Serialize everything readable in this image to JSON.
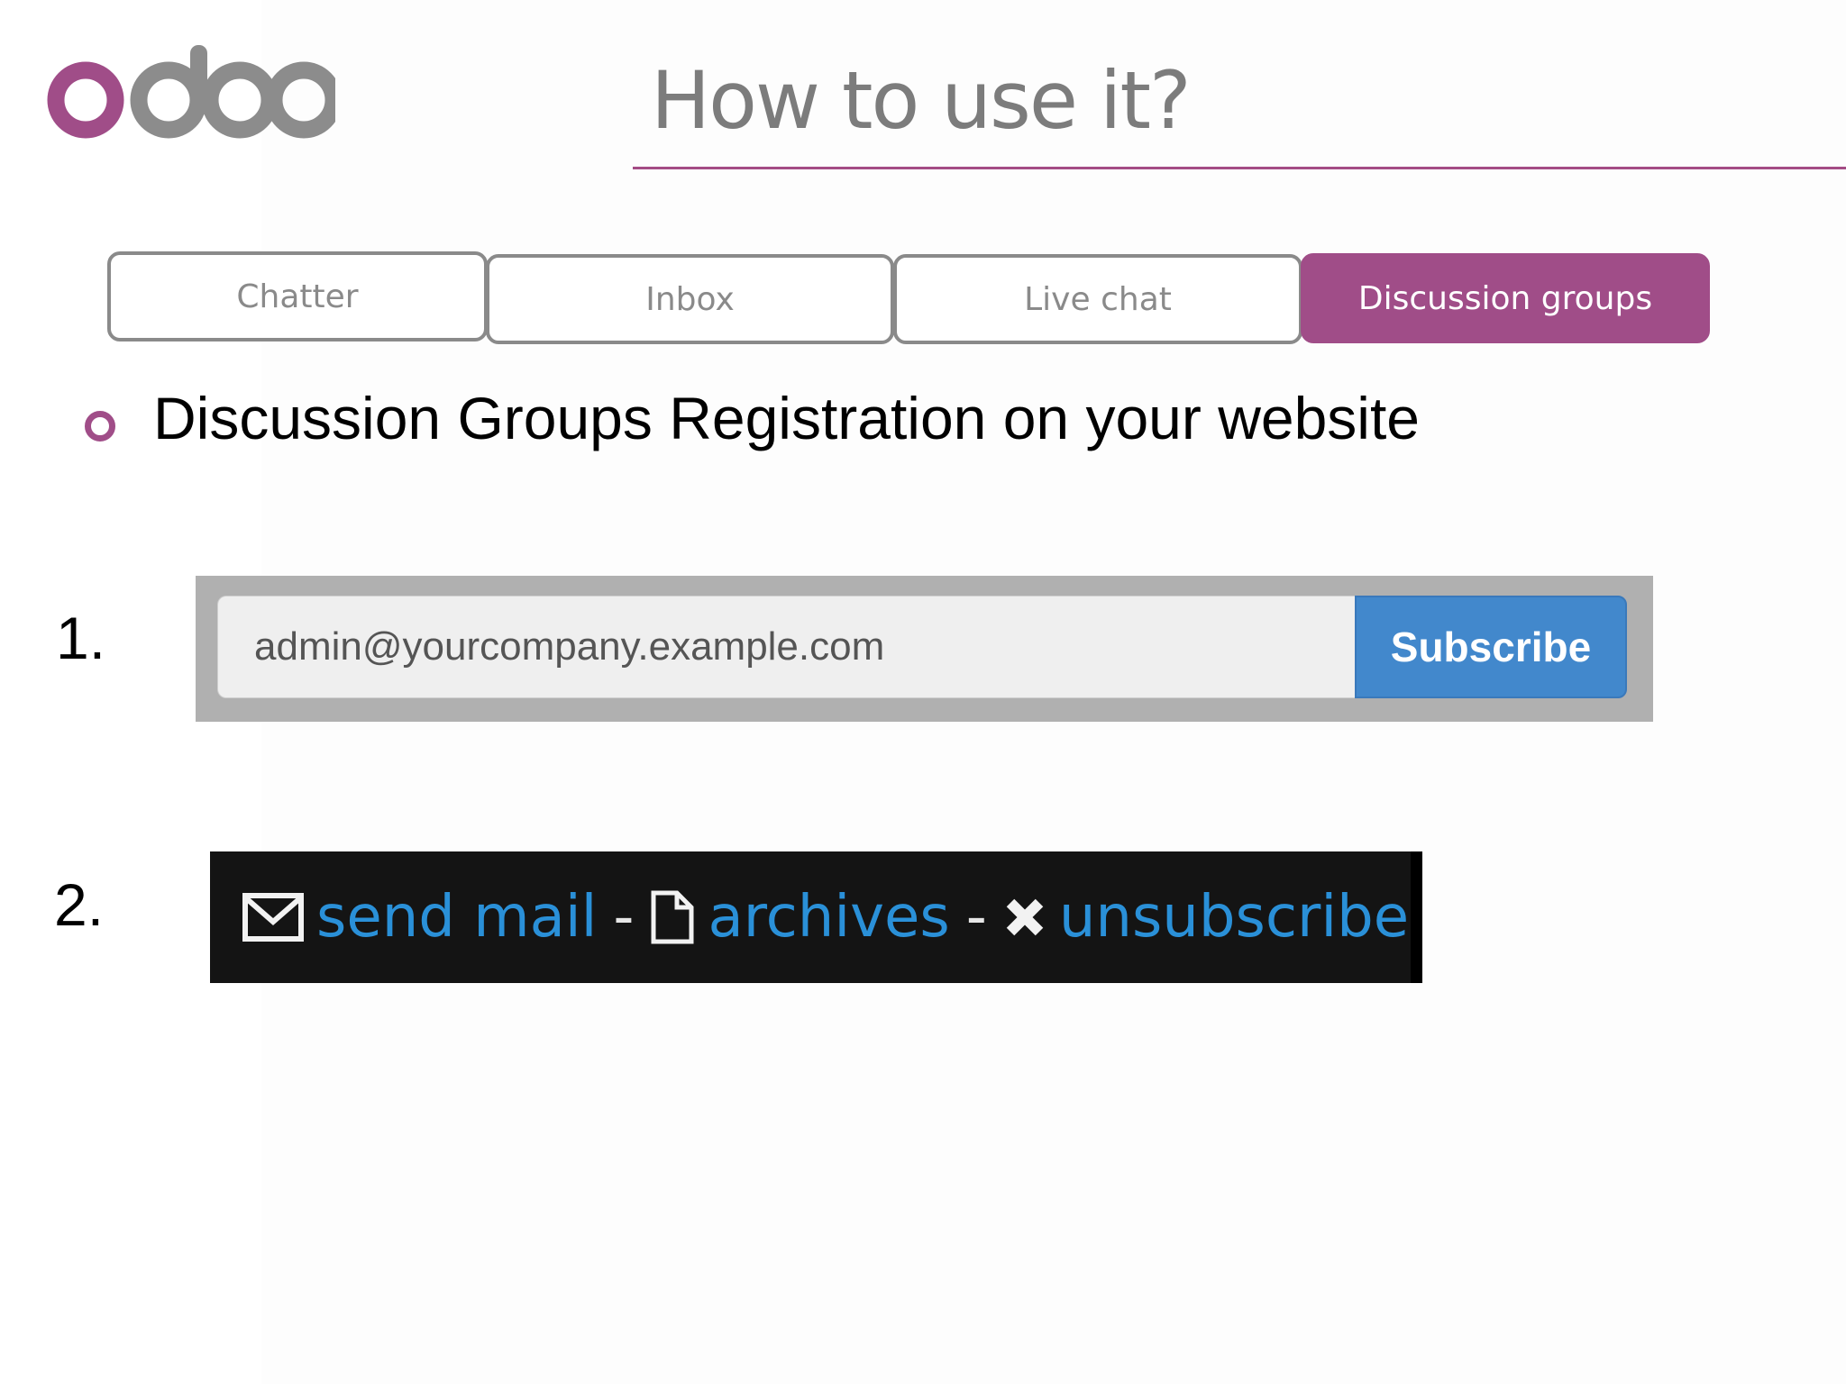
{
  "slide": {
    "brand": "odoo",
    "title": "How to use it?"
  },
  "tabs": [
    {
      "label": "Chatter",
      "active": false
    },
    {
      "label": "Inbox",
      "active": false
    },
    {
      "label": "Live chat",
      "active": false
    },
    {
      "label": "Discussion groups",
      "active": true
    }
  ],
  "bullet": {
    "text": "Discussion Groups Registration on your website"
  },
  "steps": [
    {
      "number": "1."
    },
    {
      "number": "2."
    }
  ],
  "subscribe_widget": {
    "email_value": "admin@yourcompany.example.com",
    "button_label": "Subscribe"
  },
  "links_bar": {
    "send_mail": "send mail",
    "archives": "archives",
    "unsubscribe": "unsubscribe",
    "separator": "-"
  },
  "colors": {
    "brand_purple": "#a04d88",
    "brand_gray": "#8c8c8c",
    "link_blue": "#2a90d8",
    "button_blue": "#4288cc"
  },
  "icons": [
    "envelope-icon",
    "file-icon",
    "close-icon"
  ]
}
